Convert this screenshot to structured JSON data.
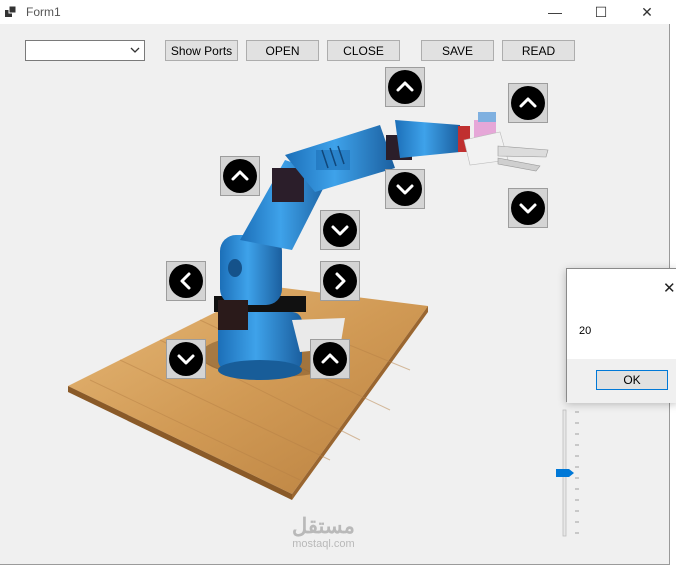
{
  "window": {
    "title": "Form1",
    "minimize_glyph": "—",
    "maximize_glyph": "☐",
    "close_glyph": "✕"
  },
  "toolbar": {
    "port_select_value": "",
    "show_ports_label": "Show Ports",
    "open_label": "OPEN",
    "close_label": "CLOSE",
    "save_label": "SAVE",
    "read_label": "READ"
  },
  "robot_controls": [
    {
      "name": "wrist-up",
      "icon": "chevron-up-icon"
    },
    {
      "name": "gripper-up",
      "icon": "chevron-up-icon"
    },
    {
      "name": "elbow-up",
      "icon": "chevron-up-icon"
    },
    {
      "name": "wrist-down",
      "icon": "chevron-down-icon"
    },
    {
      "name": "gripper-down",
      "icon": "chevron-down-icon"
    },
    {
      "name": "elbow-down",
      "icon": "chevron-down-icon"
    },
    {
      "name": "base-left",
      "icon": "chevron-left-icon"
    },
    {
      "name": "base-right",
      "icon": "chevron-right-icon"
    },
    {
      "name": "shoulder-down",
      "icon": "chevron-down-icon"
    },
    {
      "name": "shoulder-up",
      "icon": "chevron-up-icon"
    }
  ],
  "slider": {
    "value_fraction": 0.5
  },
  "message_box": {
    "text": "20",
    "ok_label": "OK",
    "close_glyph": "✕"
  },
  "watermark": {
    "arabic": "مستقل",
    "latin": "mostaql.com"
  },
  "colors": {
    "robot_blue": "#2f8fd8",
    "wood": "#d7a664",
    "slider_accent": "#0078d7"
  }
}
